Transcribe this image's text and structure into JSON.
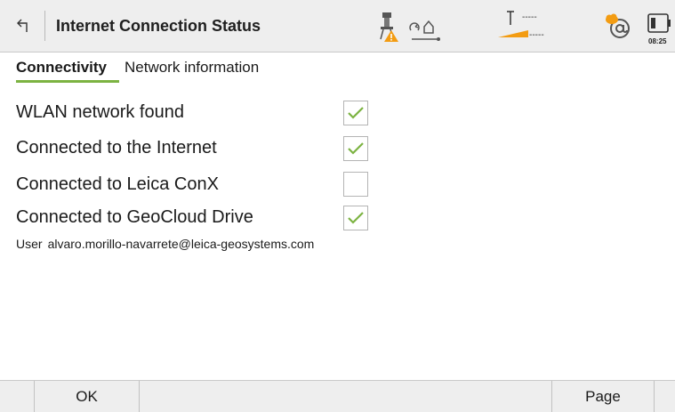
{
  "header": {
    "title": "Internet Connection Status",
    "time": "08:25",
    "status_icons": [
      "instrument-warning-icon",
      "link-home-icon",
      "height-status-icon",
      "cloud-at-icon",
      "battery-icon"
    ],
    "height_dashes_top": "-----",
    "height_dashes_bottom": "-----"
  },
  "tabs": [
    {
      "label": "Connectivity",
      "active": true
    },
    {
      "label": "Network information",
      "active": false
    }
  ],
  "rows": [
    {
      "label": "WLAN network found",
      "checked": true
    },
    {
      "label": "Connected to the Internet",
      "checked": true
    },
    {
      "label": "Connected to Leica ConX",
      "checked": false
    },
    {
      "label": "Connected to GeoCloud Drive",
      "checked": true
    }
  ],
  "user": {
    "label": "User",
    "value": "alvaro.morillo-navarrete@leica-geosystems.com"
  },
  "softkeys": {
    "ok": "OK",
    "page": "Page"
  },
  "colors": {
    "accent_green": "#7cb342",
    "warning_orange": "#f39c12",
    "bar_background": "#eeeeee"
  }
}
